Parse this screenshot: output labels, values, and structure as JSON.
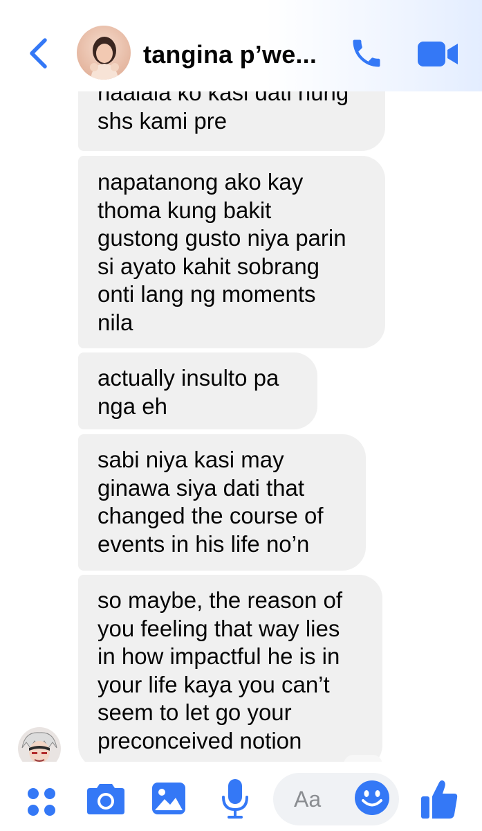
{
  "header": {
    "title": "tangina p’we...",
    "accent_color": "#3478f6",
    "back_icon": "chevron-left-icon",
    "call_icon": "phone-icon",
    "video_icon": "video-camera-icon"
  },
  "messages": [
    {
      "text": "naalala ko kasi dati nung\nshs kami pre"
    },
    {
      "text": "napatanong ako kay\nthoma kung bakit\ngustong gusto niya parin\nsi ayato kahit sobrang\nonti lang ng moments\nnila"
    },
    {
      "text": "actually insulto pa\nnga eh"
    },
    {
      "text": "sabi niya kasi may\nginawa siya dati that\nchanged the course of\nevents in his life no’n"
    },
    {
      "text": "so maybe, the reason of\nyou feeling that way lies\nin how impactful he is in\nyour life kaya you can’t\nseem to let go your\npreconceived notion"
    }
  ],
  "bubble_color": "#f0f0f0",
  "composer": {
    "placeholder": "Aa",
    "icons": [
      "four-dots-menu-icon",
      "camera-icon",
      "image-gallery-icon",
      "microphone-icon",
      "emoji-icon",
      "thumbs-up-icon"
    ]
  }
}
